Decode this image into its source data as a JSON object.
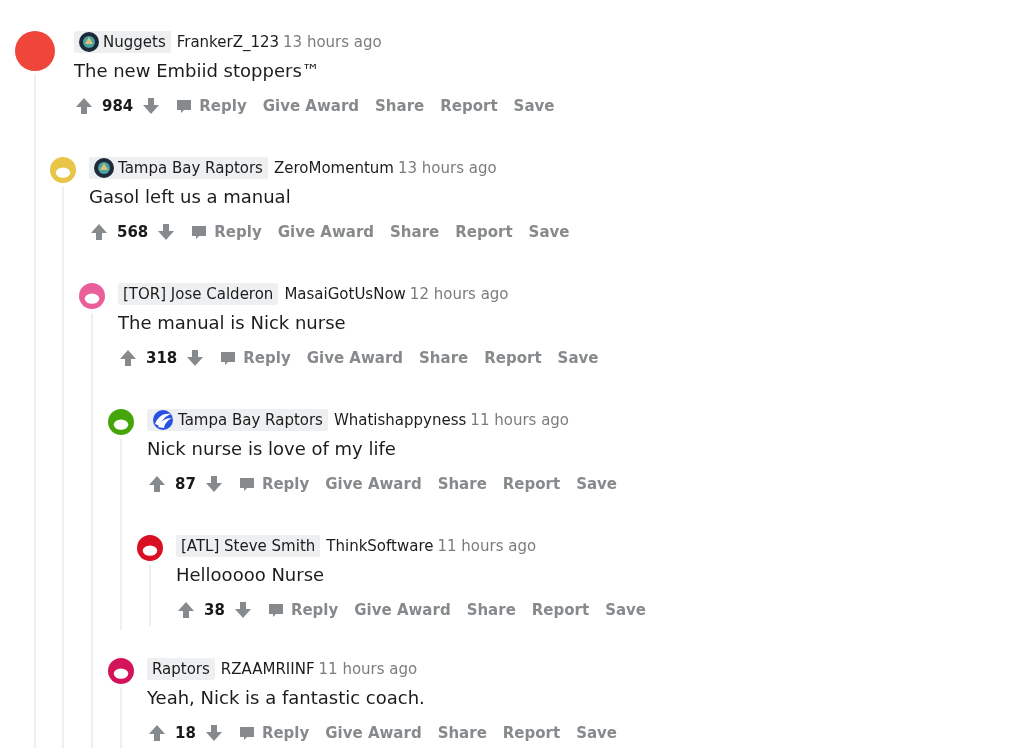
{
  "comments": [
    {
      "color": "#f0453a",
      "flair": {
        "kind": "badge",
        "text": "Nuggets"
      },
      "username": "FrankerZ_123",
      "time": "13 hours ago",
      "body": "The new Embiid stoppers™",
      "votes": "984",
      "actions": [
        "Reply",
        "Give Award",
        "Share",
        "Report",
        "Save"
      ],
      "children": [
        {
          "color": "#e8c547",
          "flair": {
            "kind": "badge",
            "text": "Tampa Bay Raptors"
          },
          "username": "ZeroMomentum",
          "time": "13 hours ago",
          "body": "Gasol left us a manual",
          "votes": "568",
          "actions": [
            "Reply",
            "Give Award",
            "Share",
            "Report",
            "Save"
          ],
          "children": [
            {
              "color": "#ea5f9a",
              "flair": {
                "text": "[TOR] Jose Calderon"
              },
              "username": "MasaiGotUsNow",
              "time": "12 hours ago",
              "body": "The manual is Nick nurse",
              "votes": "318",
              "actions": [
                "Reply",
                "Give Award",
                "Share",
                "Report",
                "Save"
              ],
              "children": [
                {
                  "color": "#46a508",
                  "flair": {
                    "kind": "claw",
                    "text": "Tampa Bay Raptors"
                  },
                  "username": "Whatishappyness",
                  "time": "11 hours ago",
                  "body": "Nick nurse is love of my life",
                  "votes": "87",
                  "actions": [
                    "Reply",
                    "Give Award",
                    "Share",
                    "Report",
                    "Save"
                  ],
                  "children": [
                    {
                      "color": "#db0f24",
                      "flair": {
                        "text": "[ATL] Steve Smith"
                      },
                      "username": "ThinkSoftware",
                      "time": "11 hours ago",
                      "body": "Hellooooo Nurse",
                      "votes": "38",
                      "actions": [
                        "Reply",
                        "Give Award",
                        "Share",
                        "Report",
                        "Save"
                      ]
                    }
                  ]
                },
                {
                  "color": "#d4145a",
                  "flair": {
                    "text": "Raptors"
                  },
                  "username": "RZAAMRIINF",
                  "time": "11 hours ago",
                  "body": "Yeah, Nick is a fantastic coach.",
                  "votes": "18",
                  "actions": [
                    "Reply",
                    "Give Award",
                    "Share",
                    "Report",
                    "Save"
                  ]
                }
              ]
            }
          ]
        }
      ]
    }
  ]
}
